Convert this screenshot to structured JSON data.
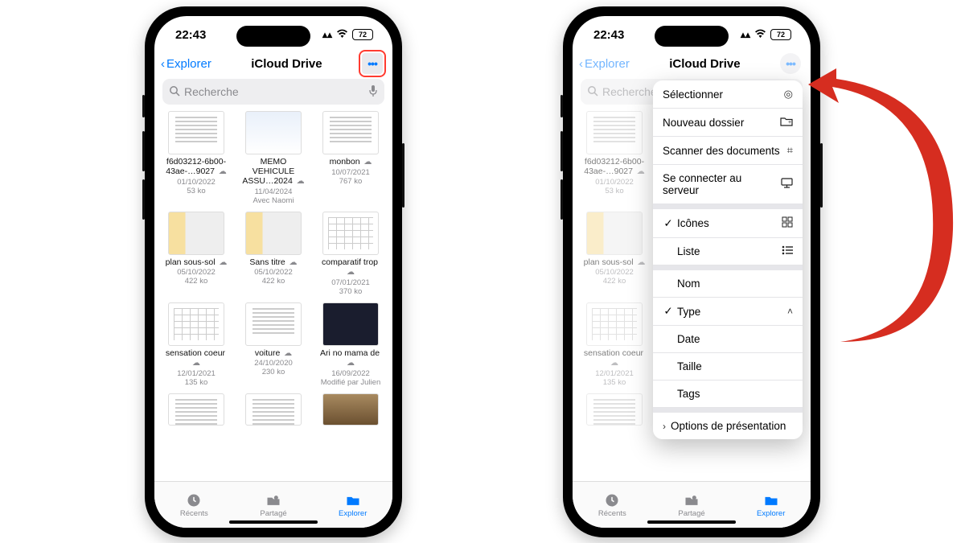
{
  "status": {
    "time": "22:43",
    "battery": "72"
  },
  "nav": {
    "back_label": "Explorer",
    "title": "iCloud Drive"
  },
  "search": {
    "placeholder": "Recherche"
  },
  "files": [
    {
      "name": "f6d03212-6b00-43ae-…9027",
      "date": "01/10/2022",
      "size": "53 ko",
      "thumb": "doc"
    },
    {
      "name": "MEMO VEHICULE ASSU…2024",
      "date": "11/04/2024",
      "size": "Avec Naomi",
      "thumb": "colored"
    },
    {
      "name": "monbon",
      "date": "10/07/2021",
      "size": "767 ko",
      "thumb": "doc"
    },
    {
      "name": "plan sous-sol",
      "date": "05/10/2022",
      "size": "422 ko",
      "thumb": "plan"
    },
    {
      "name": "Sans titre",
      "date": "05/10/2022",
      "size": "422 ko",
      "thumb": "plan"
    },
    {
      "name": "comparatif trop",
      "date": "07/01/2021",
      "size": "370 ko",
      "thumb": "table"
    },
    {
      "name": "sensation coeur",
      "date": "12/01/2021",
      "size": "135 ko",
      "thumb": "table"
    },
    {
      "name": "voiture",
      "date": "24/10/2020",
      "size": "230 ko",
      "thumb": "doc"
    },
    {
      "name": "Ari no mama de",
      "date": "16/09/2022",
      "size": "",
      "extra": "Modifié par Julien",
      "thumb": "dark"
    }
  ],
  "bottom_row_thumbs": [
    "doc",
    "doc",
    "photo"
  ],
  "tabs": {
    "recents": "Récents",
    "shared": "Partagé",
    "browse": "Explorer"
  },
  "menu": {
    "select": "Sélectionner",
    "new_folder": "Nouveau dossier",
    "scan": "Scanner des documents",
    "connect": "Se connecter au serveur",
    "icons": "Icônes",
    "list": "Liste",
    "name": "Nom",
    "type": "Type",
    "date": "Date",
    "size": "Taille",
    "tags": "Tags",
    "options": "Options de présentation"
  },
  "colors": {
    "accent": "#007aff",
    "highlight": "#ff3b30",
    "arrow": "#d62d20"
  }
}
